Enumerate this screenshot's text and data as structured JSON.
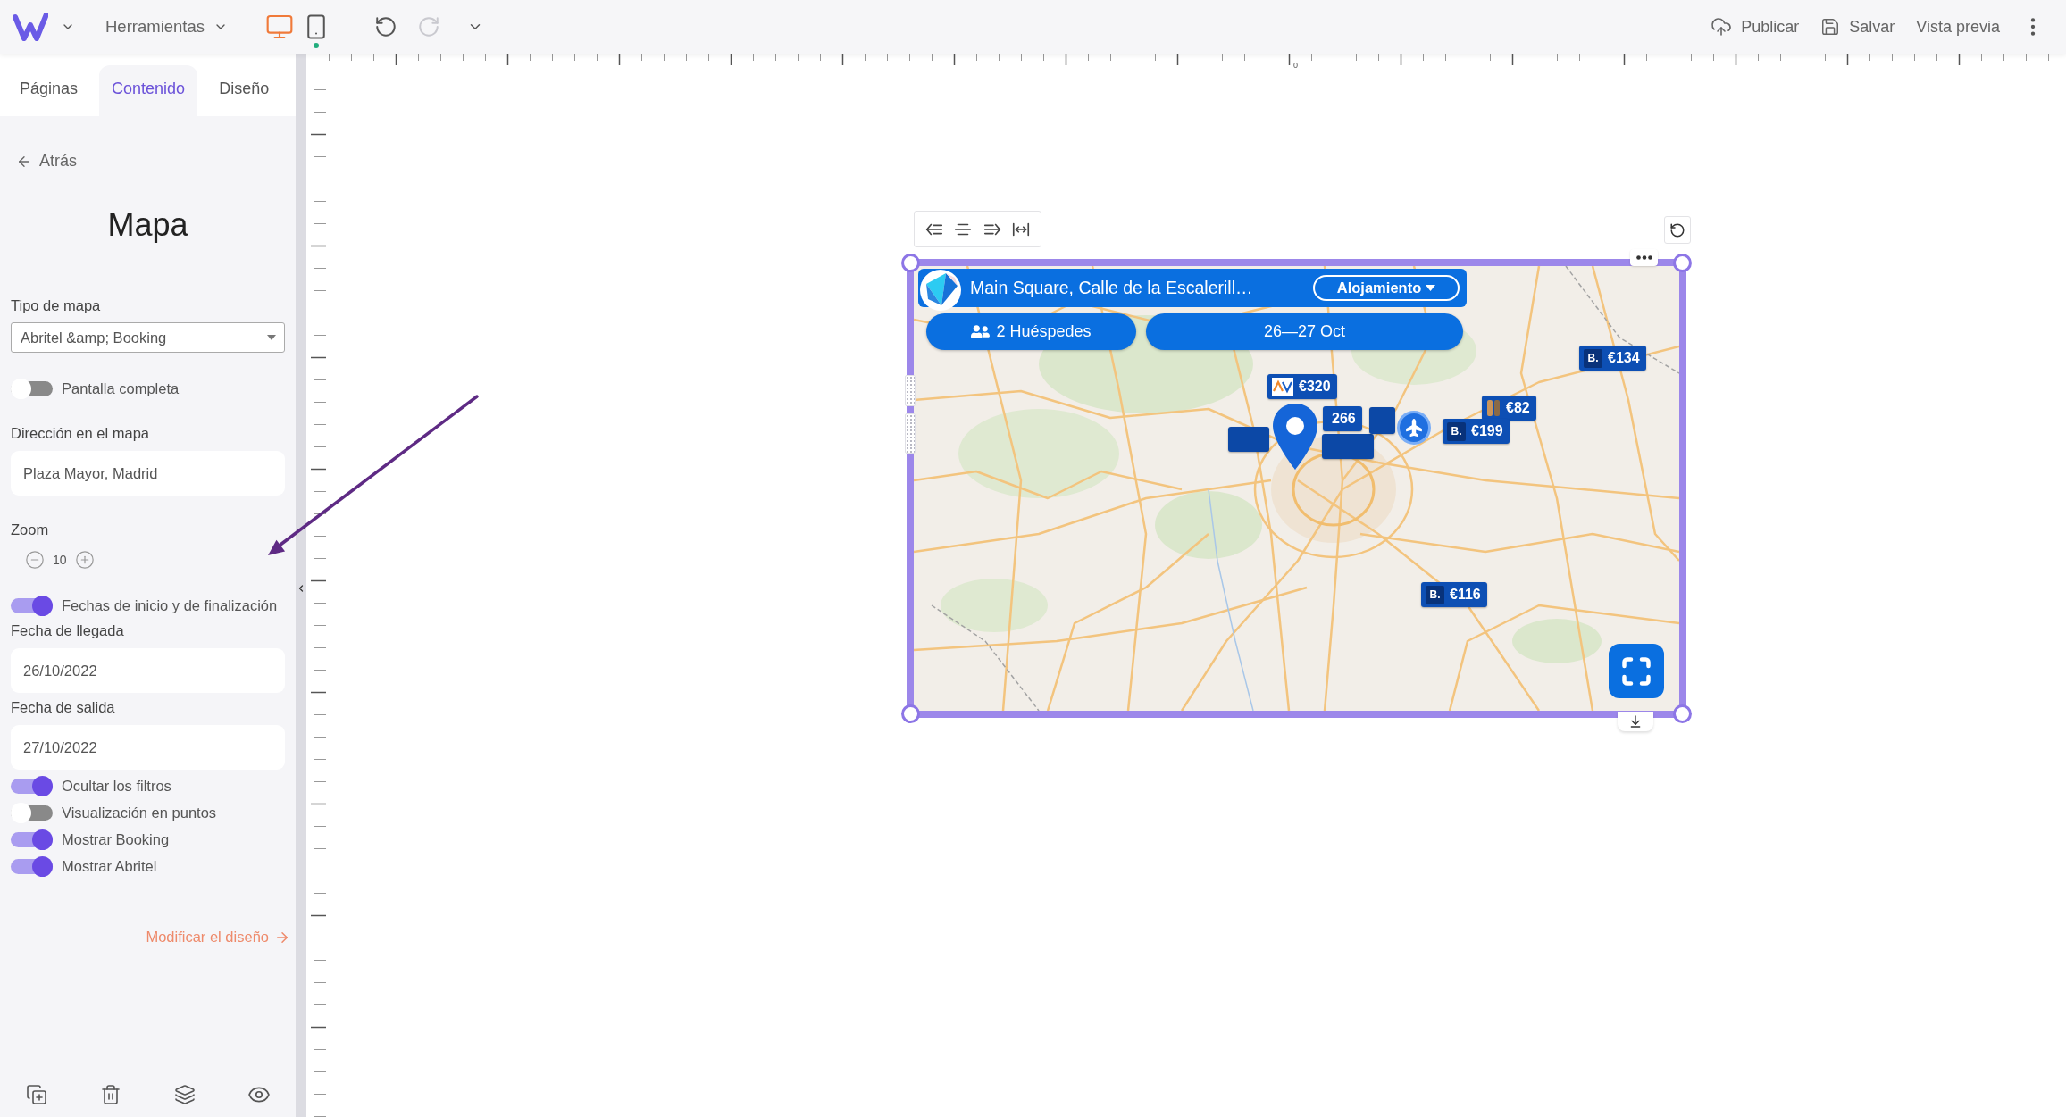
{
  "topbar": {
    "tools_menu": "Herramientas",
    "devices": [
      {
        "kind": "desktop",
        "selected": true,
        "indicator": false
      },
      {
        "kind": "mobile",
        "selected": false,
        "indicator": true
      }
    ],
    "history": [
      {
        "kind": "undo",
        "disabled": false
      },
      {
        "kind": "redo",
        "disabled": true
      }
    ],
    "actions": [
      {
        "kind": "publish",
        "label": "Publicar"
      },
      {
        "kind": "save",
        "label": "Salvar"
      },
      {
        "kind": "preview",
        "label": "Vista previa"
      }
    ]
  },
  "sidebar": {
    "tabs": [
      {
        "label": "Páginas",
        "selected": false
      },
      {
        "label": "Contenido",
        "selected": true
      },
      {
        "label": "Diseño",
        "selected": false
      }
    ],
    "back": "Atrás",
    "title": "Mapa",
    "sections": [
      {
        "controls": [
          {
            "kind": "select",
            "label": "Tipo de mapa",
            "value": "Abritel &amp; Booking"
          }
        ]
      },
      {
        "controls": [
          {
            "kind": "toggle",
            "label": "Pantalla completa",
            "on": false
          }
        ]
      },
      {
        "controls": [
          {
            "kind": "input",
            "label": "Dirección en el mapa",
            "value": "Plaza Mayor, Madrid"
          }
        ]
      },
      {
        "controls": [
          {
            "kind": "zoom",
            "label": "Zoom",
            "value": "10"
          }
        ]
      },
      {
        "controls": [
          {
            "kind": "toggle",
            "label": "Fechas de inicio y de finalización",
            "on": true
          },
          {
            "kind": "input",
            "label": "Fecha de llegada",
            "value": "26/10/2022"
          },
          {
            "kind": "input",
            "label": "Fecha de salida",
            "value": "27/10/2022"
          },
          {
            "kind": "toggle",
            "label": "Ocultar los filtros",
            "on": true
          },
          {
            "kind": "toggle",
            "label": "Visualización en puntos",
            "on": false
          },
          {
            "kind": "toggle",
            "label": "Mostrar Booking",
            "on": true
          },
          {
            "kind": "toggle",
            "label": "Mostrar Abritel",
            "on": true
          }
        ]
      }
    ],
    "link": "Modificar el diseño"
  },
  "canvas": {
    "ruler_origin": "0",
    "map": {
      "search": {
        "value": "Main Square, Calle de la Escalerill…",
        "category": "Alojamiento"
      },
      "guests": "2 Huéspedes",
      "dates": "26—27 Oct",
      "markers": [
        {
          "kind": "chevrons",
          "price": "€320"
        },
        {
          "kind": "plain",
          "price": "266"
        },
        {
          "kind": "letter",
          "logo": "B.",
          "price": "€134"
        },
        {
          "kind": "bars",
          "price": "€82"
        },
        {
          "kind": "letter",
          "logo": "B.",
          "price": "€199"
        },
        {
          "kind": "letter",
          "logo": "B.",
          "price": "€116"
        }
      ]
    }
  }
}
